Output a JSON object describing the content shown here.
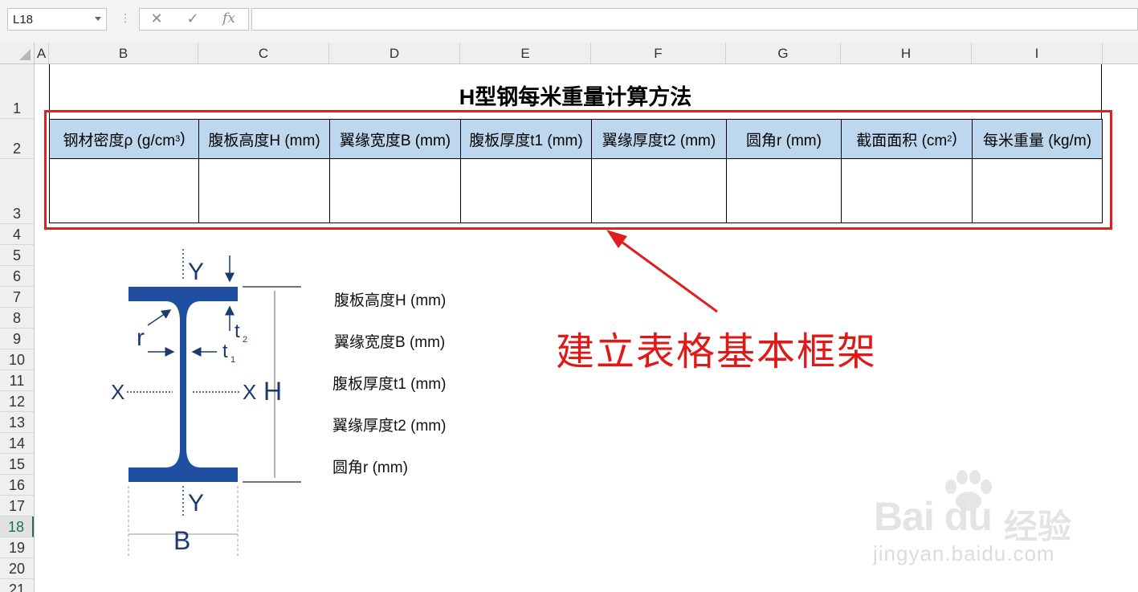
{
  "formula_bar": {
    "name_box": "L18",
    "cancel_symbol": "✕",
    "enter_symbol": "✓",
    "fx_symbol": "fx",
    "formula": ""
  },
  "columns": [
    "A",
    "B",
    "C",
    "D",
    "E",
    "F",
    "G",
    "H",
    "I"
  ],
  "rows": [
    "1",
    "2",
    "3",
    "4",
    "5",
    "6",
    "7",
    "8",
    "9",
    "10",
    "11",
    "12",
    "13",
    "14",
    "15",
    "16",
    "17",
    "18",
    "19",
    "20",
    "21"
  ],
  "selected_row": "18",
  "sheet": {
    "title": "H型钢每米重量计算方法",
    "headers": [
      {
        "text": "钢材密度ρ (g/cm",
        "sup": "3",
        "tail": ")"
      },
      {
        "text": "腹板高度H (mm)",
        "sup": "",
        "tail": ""
      },
      {
        "text": "翼缘宽度B (mm)",
        "sup": "",
        "tail": ""
      },
      {
        "text": "腹板厚度t1 (mm)",
        "sup": "",
        "tail": ""
      },
      {
        "text": "翼缘厚度t2 (mm)",
        "sup": "",
        "tail": ""
      },
      {
        "text": "圆角r (mm)",
        "sup": "",
        "tail": ""
      },
      {
        "text": "截面面积 (cm",
        "sup": "2",
        "tail": ")"
      },
      {
        "text": "每米重量 (kg/m)",
        "sup": "",
        "tail": ""
      }
    ]
  },
  "diagram": {
    "symbols": {
      "y_top": "Y",
      "y_bottom": "Y",
      "x_left": "X",
      "x_right": "X",
      "h": "H",
      "b": "B",
      "r": "r",
      "t1": "t",
      "t1_sub": "1",
      "t2": "t",
      "t2_sub": "2"
    },
    "labels": [
      "腹板高度H (mm)",
      "翼缘宽度B (mm)",
      "腹板厚度t1 (mm)",
      "翼缘厚度t2 (mm)",
      "圆角r (mm)"
    ],
    "steel_color": "#1f4fa0"
  },
  "annotation": {
    "text": "建立表格基本框架",
    "color": "#e11818"
  },
  "watermark": {
    "logo": "Bai du",
    "jingyan": "经验",
    "url": "jingyan.baidu.com"
  }
}
